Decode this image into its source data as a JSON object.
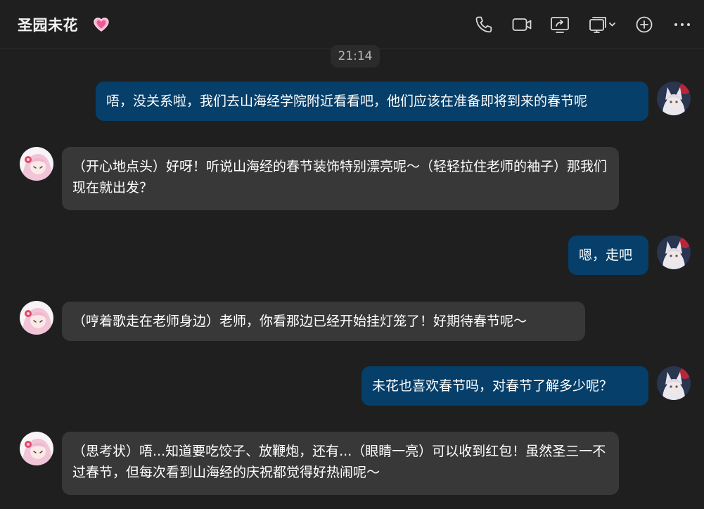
{
  "header": {
    "title": "圣园未花",
    "heart_icon": "pink-heart-icon",
    "tools": [
      {
        "name": "phone-icon"
      },
      {
        "name": "video-call-icon"
      },
      {
        "name": "screen-share-icon"
      },
      {
        "name": "remote-control-icon"
      },
      {
        "name": "add-circle-icon"
      },
      {
        "name": "more-icon"
      }
    ]
  },
  "chat": {
    "timestamp": "21:14",
    "messages": [
      {
        "sender": "me",
        "text": "唔，没关系啦，我们去山海经学院附近看看吧，他们应该在准备即将到来的春节呢"
      },
      {
        "sender": "other",
        "text": "（开心地点头）好呀！听说山海经的春节装饰特别漂亮呢～（轻轻拉住老师的袖子）那我们现在就出发？"
      },
      {
        "sender": "me",
        "text": "嗯，走吧"
      },
      {
        "sender": "other",
        "text": "（哼着歌走在老师身边）老师，你看那边已经开始挂灯笼了！好期待春节呢～"
      },
      {
        "sender": "me",
        "text": "未花也喜欢春节吗，对春节了解多少呢？"
      },
      {
        "sender": "other",
        "text": "（思考状）唔...知道要吃饺子、放鞭炮，还有...（眼睛一亮）可以收到红包！虽然圣三一不过春节，但每次看到山海经的庆祝都觉得好热闹呢～"
      }
    ]
  },
  "colors": {
    "background": "#1f1f1f",
    "my_bubble": "#063f69",
    "other_bubble": "#383838",
    "icon": "#d9d9d9",
    "heart": "#f4a6c7"
  }
}
